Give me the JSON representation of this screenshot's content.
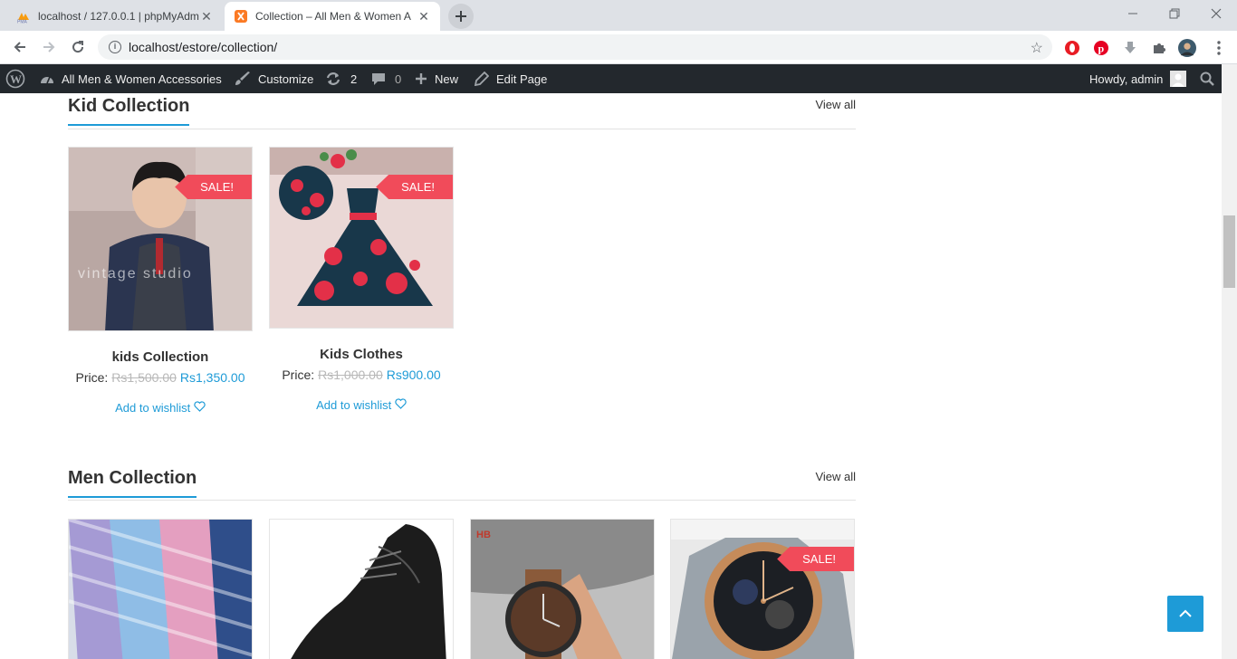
{
  "browser": {
    "tabs": [
      {
        "title": "localhost / 127.0.0.1 | phpMyAdm",
        "active": false
      },
      {
        "title": "Collection – All Men & Women A",
        "active": true
      }
    ],
    "url": "localhost/estore/collection/"
  },
  "adminbar": {
    "site_name": "All Men & Women Accessories",
    "customize": "Customize",
    "updates_count": "2",
    "comments_count": "0",
    "new": "New",
    "edit_page": "Edit Page",
    "howdy": "Howdy, admin"
  },
  "kid_section": {
    "title": "Kid Collection",
    "view_all": "View all",
    "products": [
      {
        "name": "kids Collection",
        "price_label": "Price:",
        "old_price": "Rs1,500.00",
        "new_price": "Rs1,350.00",
        "sale": "SALE!",
        "wishlist": "Add to wishlist"
      },
      {
        "name": "Kids Clothes",
        "price_label": "Price:",
        "old_price": "Rs1,000.00",
        "new_price": "Rs900.00",
        "sale": "SALE!",
        "wishlist": "Add to wishlist"
      }
    ]
  },
  "men_section": {
    "title": "Men Collection",
    "view_all": "View all",
    "products": [
      {
        "image": "ties"
      },
      {
        "image": "leather-shoe"
      },
      {
        "image": "wrist-watch"
      },
      {
        "image": "gold-watch",
        "sale": "SALE!"
      }
    ]
  },
  "colors": {
    "accent": "#1e9bd7",
    "sale": "#f14b5a",
    "adminbar": "#23282d"
  }
}
